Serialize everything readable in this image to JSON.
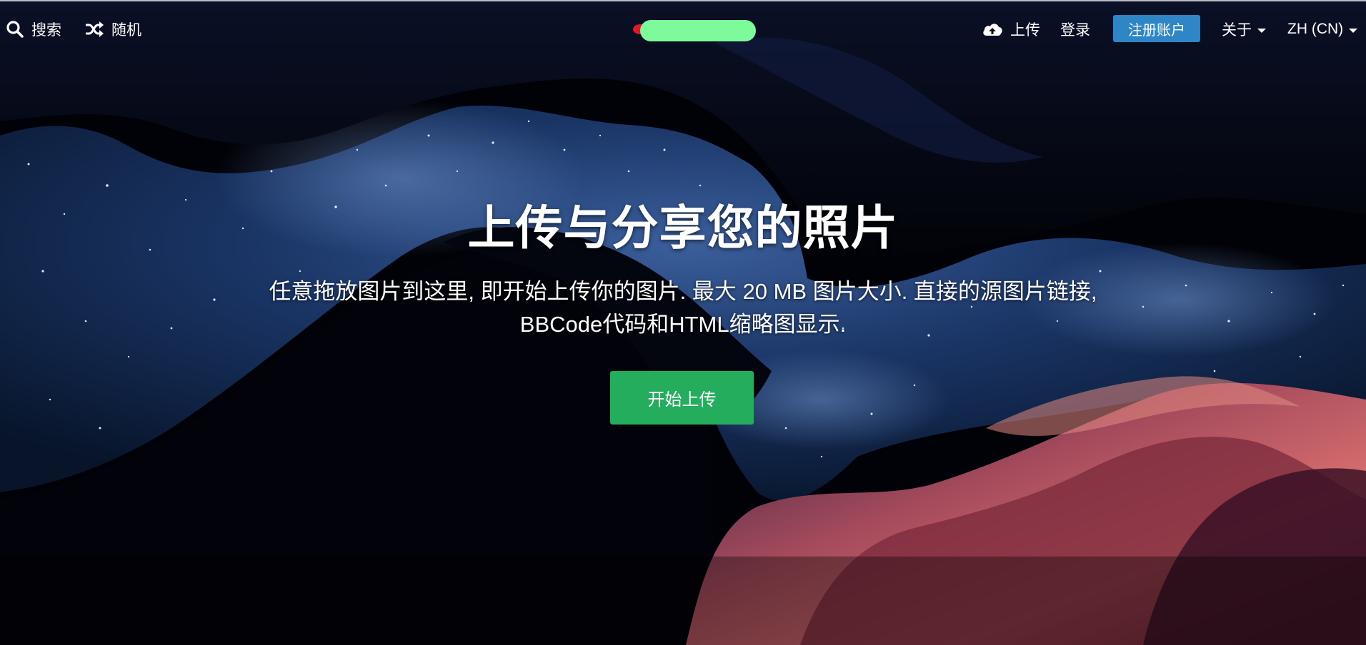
{
  "nav": {
    "search_label": "搜索",
    "random_label": "随机",
    "upload_label": "上传",
    "login_label": "登录",
    "signup_label": "注册账户",
    "about_label": "关于",
    "language_label": "ZH (CN)"
  },
  "hero": {
    "title": "上传与分享您的照片",
    "description": "任意拖放图片到这里, 即开始上传你的图片. 最大 20 MB 图片大小. 直接的源图片链接, BBCode代码和HTML缩略图显示.",
    "start_button_label": "开始上传"
  },
  "colors": {
    "signup_button": "#2f86c6",
    "start_button": "#23ad5c",
    "logo_highlight": "#7dfb9a",
    "logo_accent": "#e0182a"
  },
  "icons": {
    "search": "search-icon",
    "random": "shuffle-icon",
    "upload": "cloud-upload-icon"
  }
}
